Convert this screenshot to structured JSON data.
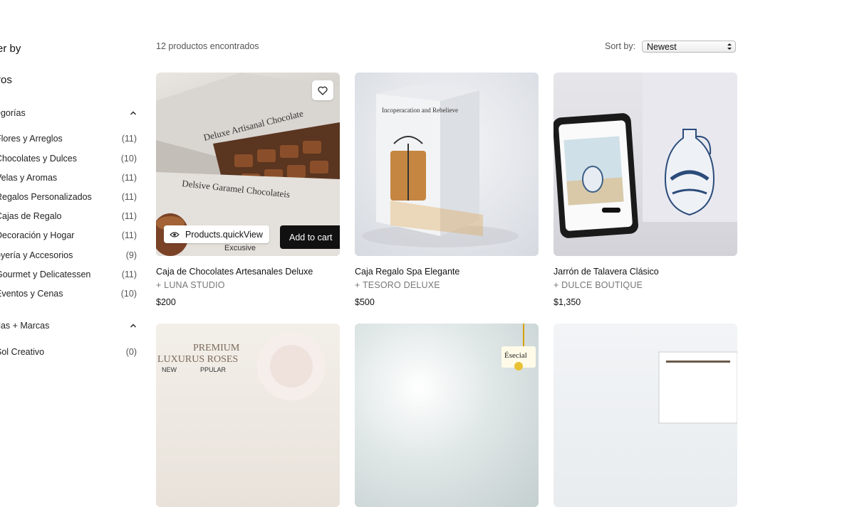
{
  "sidebar": {
    "title": "er by",
    "subtitle": "ros",
    "categories_header": "egorías",
    "categories": [
      {
        "label": "Flores y Arreglos",
        "count": "(11)"
      },
      {
        "label": "Chocolates y Dulces",
        "count": "(10)"
      },
      {
        "label": "Velas y Aromas",
        "count": "(11)"
      },
      {
        "label": "Regalos Personalizados",
        "count": "(11)"
      },
      {
        "label": "Cajas de Regalo",
        "count": "(11)"
      },
      {
        "label": "Decoración y Hogar",
        "count": "(11)"
      },
      {
        "label": "oyería y Accesorios",
        "count": "(9)"
      },
      {
        "label": "Gourmet y Delicatessen",
        "count": "(11)"
      },
      {
        "label": "Eventos y Cenas",
        "count": "(10)"
      }
    ],
    "brands_header": "das + Marcas",
    "brands": [
      {
        "label": "Sol Creativo",
        "count": "(0)"
      }
    ]
  },
  "toolbar": {
    "results": "12 productos encontrados",
    "sort_label": "Sort by:",
    "sort_value": "Newest"
  },
  "products": [
    {
      "name": "Caja de Chocolates Artesanales Deluxe",
      "brand": "+ LUNA STUDIO",
      "price": "$200",
      "quickview": "Products.quickView",
      "add_to_cart": "Add to cart",
      "box_text_1": "Deluxe Artisanal Chocolate",
      "box_text_2": "Delsive Garamel Chocolateis",
      "box_tag": "Excusive"
    },
    {
      "name": "Caja Regalo Spa Elegante",
      "brand": "+ TESORO DELUXE",
      "price": "$500",
      "box_text_1": "Incoperacation and Rebelieve"
    },
    {
      "name": "Jarrón de Talavera Clásico",
      "brand": "+ DULCE BOUTIQUE",
      "price": "$1,350"
    },
    {
      "box_text_1": "PREMIUM",
      "box_text_2": "LUXURUS ROSES",
      "box_text_3": "NEW",
      "box_text_4": "PPULAR"
    },
    {
      "box_text_1": "Ésecial"
    },
    {}
  ],
  "colors": {
    "accent": "#111111",
    "muted": "#777777"
  }
}
